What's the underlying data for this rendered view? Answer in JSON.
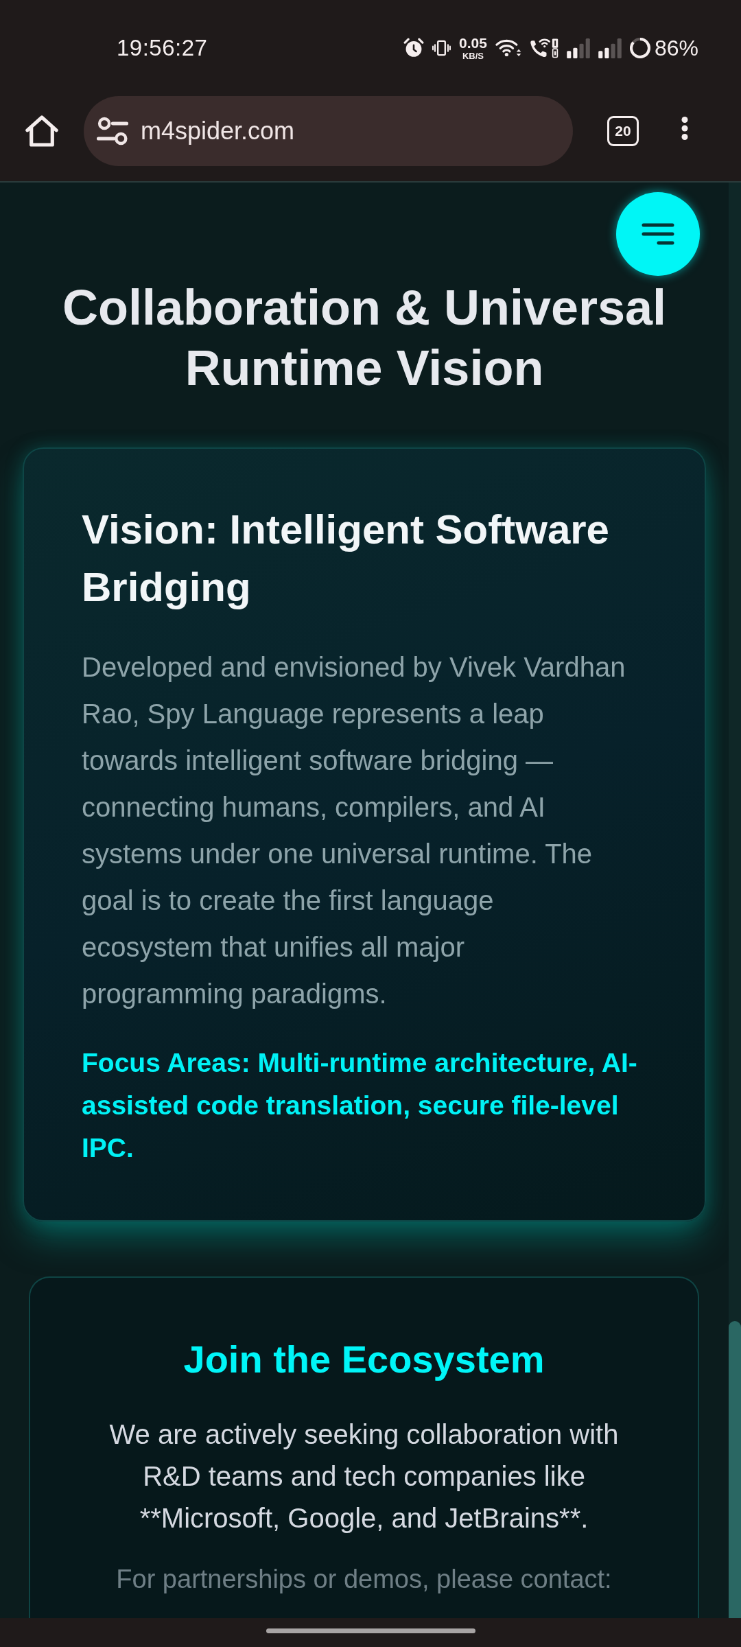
{
  "status_bar": {
    "time": "19:56:27",
    "net_speed": "0.05",
    "net_speed_unit": "KB/S",
    "battery": "86%"
  },
  "browser": {
    "url": "m4spider.com",
    "tab_count": "20"
  },
  "page": {
    "heading": "Collaboration & Universal Runtime Vision",
    "vision_card": {
      "title": "Vision: Intelligent Software Bridging",
      "description": "Developed and envisioned by Vivek Vardhan Rao, Spy Language represents a leap towards intelligent software bridging — connecting humans, compilers, and AI systems under one universal runtime. The goal is to create the first language ecosystem that unifies all major programming paradigms.",
      "focus": "Focus Areas: Multi-runtime architecture, AI-assisted code translation, secure file-level IPC."
    },
    "join_card": {
      "title": "Join the Ecosystem",
      "text": "We are actively seeking collaboration with R&D teams and tech companies like **Microsoft, Google, and JetBrains**.",
      "contact": "For partnerships or demos, please contact:"
    }
  }
}
